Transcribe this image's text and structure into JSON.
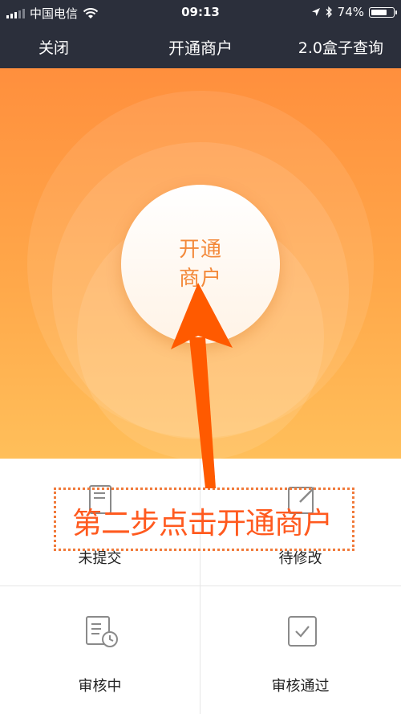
{
  "status_bar": {
    "carrier": "中国电信",
    "time": "09:13",
    "battery": "74%",
    "battery_level": 0.74
  },
  "nav": {
    "close": "关闭",
    "title": "开通商户",
    "query": "2.0盒子查询"
  },
  "hero": {
    "button_line1": "开通",
    "button_line2": "商户"
  },
  "grid": {
    "items": [
      {
        "label": "未提交",
        "icon": "document-icon"
      },
      {
        "label": "待修改",
        "icon": "edit-icon"
      },
      {
        "label": "审核中",
        "icon": "document-clock-icon"
      },
      {
        "label": "审核通过",
        "icon": "checkbox-icon"
      }
    ]
  },
  "annotation": {
    "text": "第二步点击开通商户",
    "color": "#ff5a1f"
  },
  "colors": {
    "header": "#2b2f3b",
    "hero_top": "#ff8f3d",
    "hero_bottom": "#ffbf5a",
    "accent": "#f3893a"
  }
}
